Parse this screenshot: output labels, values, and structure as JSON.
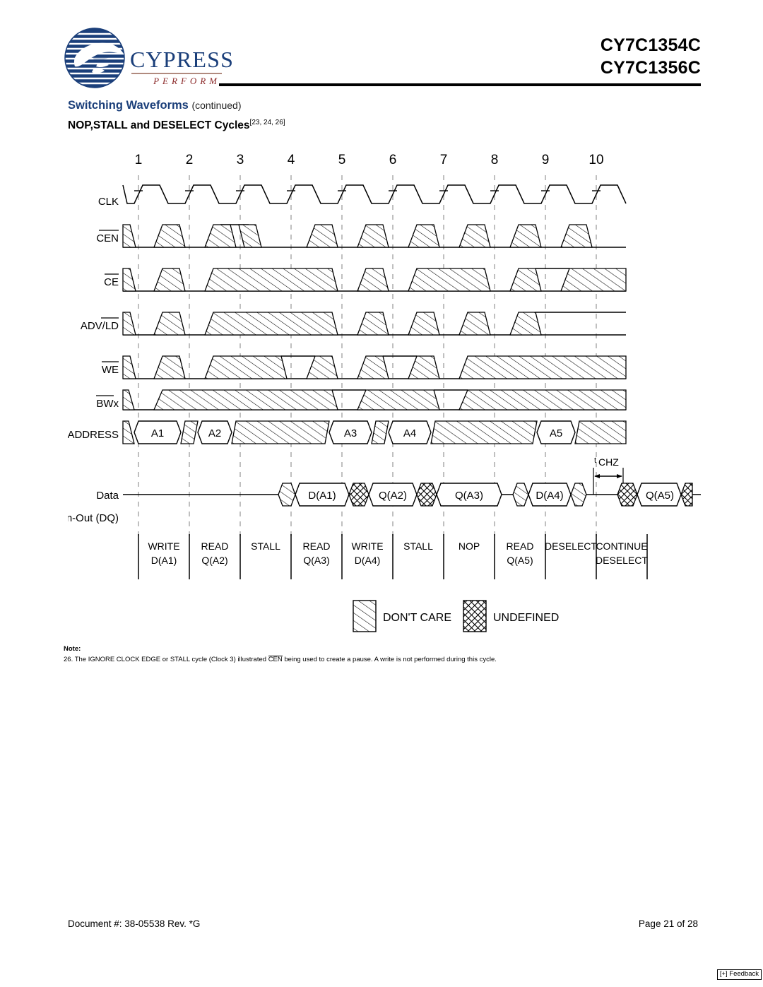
{
  "header": {
    "part_numbers": [
      "CY7C1354C",
      "CY7C1356C"
    ],
    "logo_wordmark": "CYPRESS",
    "logo_tagline": "PERFORM"
  },
  "titles": {
    "section": "Switching Waveforms",
    "section_suffix": "(continued)",
    "figure": "NOP,STALL and DESELECT Cycles",
    "figure_refs": "[23, 24, 26]"
  },
  "diagram": {
    "cycle_numbers": [
      "1",
      "2",
      "3",
      "4",
      "5",
      "6",
      "7",
      "8",
      "9",
      "10"
    ],
    "signals": [
      {
        "name": "CLK",
        "overbar": "none"
      },
      {
        "name": "CEN",
        "overbar": "full"
      },
      {
        "name": "CE",
        "overbar": "full"
      },
      {
        "name": "ADV/LD",
        "overbar": "partial"
      },
      {
        "name": "WE",
        "overbar": "full"
      },
      {
        "name": "BWx",
        "overbar": "partial"
      },
      {
        "name": "ADDRESS",
        "overbar": "none"
      }
    ],
    "data_row_label_line1": "Data",
    "data_row_label_line2": "In-Out (DQ)",
    "address_values": [
      "A1",
      "A2",
      "A3",
      "A4",
      "A5"
    ],
    "data_values": [
      "D(A1)",
      "Q(A2)",
      "Q(A3)",
      "D(A4)",
      "Q(A5)"
    ],
    "timing_annotation": {
      "superscript": "t",
      "name": "CHZ"
    },
    "operations": [
      {
        "line1": "WRITE",
        "line2": "D(A1)"
      },
      {
        "line1": "READ",
        "line2": "Q(A2)"
      },
      {
        "line1": "STALL",
        "line2": ""
      },
      {
        "line1": "READ",
        "line2": "Q(A3)"
      },
      {
        "line1": "WRITE",
        "line2": "D(A4)"
      },
      {
        "line1": "STALL",
        "line2": ""
      },
      {
        "line1": "NOP",
        "line2": ""
      },
      {
        "line1": "READ",
        "line2": "Q(A5)"
      },
      {
        "line1": "DESELECT",
        "line2": ""
      },
      {
        "line1": "CONTINUE",
        "line2": "DESELECT"
      }
    ],
    "legend": [
      {
        "pattern": "diagonal-hatch",
        "label": "DON'T CARE"
      },
      {
        "pattern": "cross-hatch",
        "label": "UNDEFINED"
      }
    ]
  },
  "note": {
    "label": "Note:",
    "number": "26.",
    "text_before": "The IGNORE CLOCK EDGE or STALL cycle (Clock 3) illustrated",
    "overbar_word": "CEN",
    "text_after": "being used to create a pause. A write is not performed during this cycle."
  },
  "footer": {
    "document": "Document #: 38-05538 Rev. *G",
    "page": "Page 21 of 28",
    "feedback": "[+] Feedback"
  },
  "colors": {
    "brand_blue": "#1b3f7a",
    "brand_red": "#8c2b2b",
    "ink": "#000000",
    "gridline": "#b0b0b0"
  }
}
